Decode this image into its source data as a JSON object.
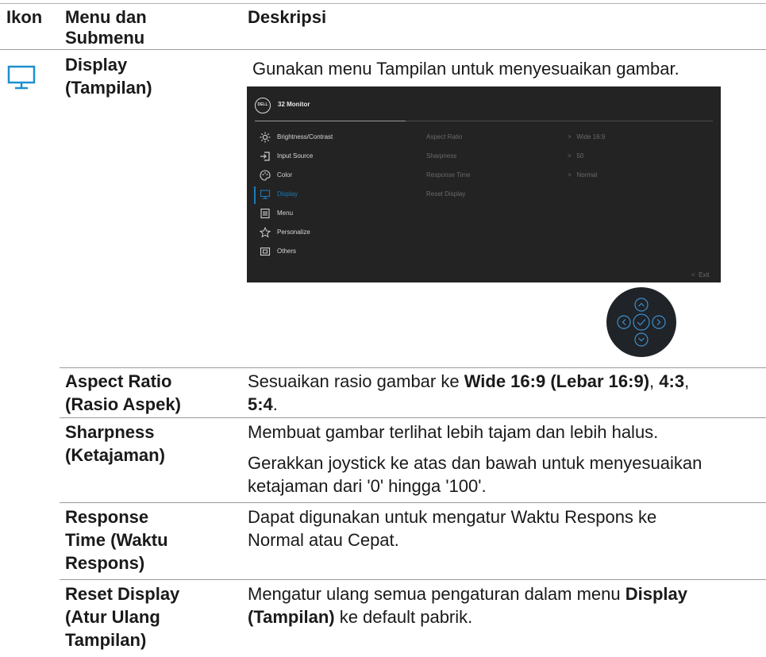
{
  "headers": {
    "icon": "Ikon",
    "menu": "Menu dan Submenu",
    "menu_line1": "Menu dan",
    "menu_line2": "Submenu",
    "desc": "Deskripsi"
  },
  "display_row": {
    "icon": "monitor-icon",
    "name_line1": "Display",
    "name_line2": "(Tampilan)",
    "description": "Gunakan menu Tampilan untuk menyesuaikan gambar."
  },
  "osd": {
    "logo": "DELL",
    "title": "32 Monitor",
    "accent_color": "#1e7ab8",
    "menu": [
      {
        "label": "Brightness/Contrast",
        "icon": "brightness-icon",
        "active": false
      },
      {
        "label": "Input Source",
        "icon": "input-icon",
        "active": false
      },
      {
        "label": "Color",
        "icon": "color-palette-icon",
        "active": false
      },
      {
        "label": "Display",
        "icon": "display-icon",
        "active": true
      },
      {
        "label": "Menu",
        "icon": "menu-icon",
        "active": false
      },
      {
        "label": "Personalize",
        "icon": "star-icon",
        "active": false
      },
      {
        "label": "Others",
        "icon": "others-icon",
        "active": false
      }
    ],
    "submenu": [
      {
        "label": "Aspect Ratio",
        "value": "Wide 16:9"
      },
      {
        "label": "Sharpness",
        "value": "50"
      },
      {
        "label": "Response Time",
        "value": "Normal"
      },
      {
        "label": "Reset Display",
        "value": ""
      }
    ],
    "exit": "Exit"
  },
  "rows": [
    {
      "name_lines": [
        "Aspect Ratio",
        "(Rasio Aspek)"
      ],
      "desc_pre": "Sesuaikan rasio gambar ke ",
      "desc_b1": "Wide 16:9 (Lebar 16:9)",
      "desc_sep1": ", ",
      "desc_b2": "4:3",
      "desc_sep2": ",",
      "desc_b3": "5:4",
      "desc_end": "."
    },
    {
      "name_lines": [
        "Sharpness",
        "(Ketajaman)"
      ],
      "desc_p1": "Membuat gambar terlihat lebih tajam dan lebih halus.",
      "desc_p2": "Gerakkan joystick ke atas dan bawah untuk menyesuaikan ketajaman dari '0' hingga '100'."
    },
    {
      "name_lines": [
        "Response",
        "Time (Waktu",
        "Respons)"
      ],
      "desc_p1": "Dapat digunakan untuk mengatur Waktu Respons ke Normal atau Cepat."
    },
    {
      "name_lines": [
        "Reset Display",
        "(Atur Ulang",
        "Tampilan)"
      ],
      "desc_pre": "Mengatur ulang semua pengaturan dalam menu ",
      "desc_b1": "Display (Tampilan)",
      "desc_end": " ke default pabrik."
    }
  ]
}
